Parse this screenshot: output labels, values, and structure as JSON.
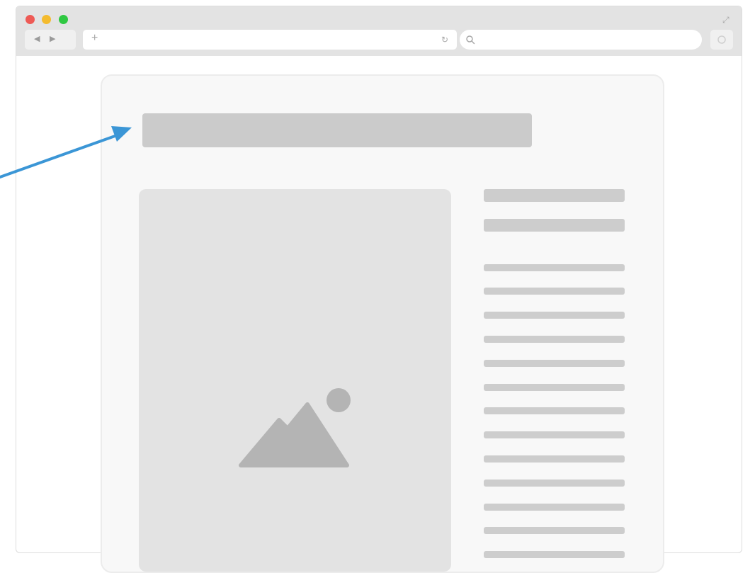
{
  "window": {
    "traffic_lights": [
      {
        "name": "close",
        "color": "#ee5a55"
      },
      {
        "name": "minimize",
        "color": "#f4bb2e"
      },
      {
        "name": "maximize",
        "color": "#2fc842"
      }
    ],
    "nav": {
      "back_icon": "◀",
      "forward_icon": "▶"
    },
    "url_bar": {
      "new_tab_icon": "+",
      "reload_icon": "↻",
      "url": ""
    },
    "search_bar": {
      "search_icon": "search-icon",
      "value": ""
    },
    "fullscreen_icon": "⤢"
  },
  "wireframe": {
    "title_placeholder_color": "#cbcbcb",
    "image_placeholder_color": "#e3e3e3",
    "image_icon": "mountain-landscape-icon",
    "text_line_color": "#cdcdcd",
    "heading_lines": 2,
    "body_lines": 13
  },
  "annotation": {
    "arrow_color": "#3b96d6",
    "arrow_icon": "arrow-pointing-to-title"
  }
}
